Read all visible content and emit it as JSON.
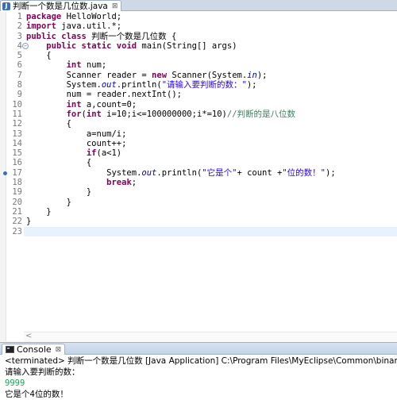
{
  "editor_tab": {
    "title": "判断一个数是几位数.java",
    "close_glyph": "⊠",
    "icon": "java-file-icon"
  },
  "editor": {
    "line_numbers": [
      "1",
      "2",
      "3",
      "4",
      "5",
      "6",
      "7",
      "8",
      "9",
      "10",
      "11",
      "12",
      "13",
      "14",
      "15",
      "16",
      "17",
      "18",
      "19",
      "20",
      "21",
      "22",
      "23"
    ],
    "lines": [
      [
        {
          "t": "kw",
          "v": "package"
        },
        {
          "t": "n",
          "v": " HelloWorld;"
        }
      ],
      [
        {
          "t": "kw",
          "v": "import"
        },
        {
          "t": "n",
          "v": " java.util.*;"
        }
      ],
      [
        {
          "t": "kw",
          "v": "public class"
        },
        {
          "t": "n",
          "v": " 判断一个数是几位数 {"
        }
      ],
      [
        {
          "t": "n",
          "v": "    "
        },
        {
          "t": "kw",
          "v": "public static void"
        },
        {
          "t": "n",
          "v": " main(String[] args)"
        }
      ],
      [
        {
          "t": "n",
          "v": "    {"
        }
      ],
      [
        {
          "t": "n",
          "v": "        "
        },
        {
          "t": "kw",
          "v": "int"
        },
        {
          "t": "n",
          "v": " num;"
        }
      ],
      [
        {
          "t": "n",
          "v": "        Scanner reader = "
        },
        {
          "t": "kw",
          "v": "new"
        },
        {
          "t": "n",
          "v": " Scanner(System."
        },
        {
          "t": "fld",
          "v": "in"
        },
        {
          "t": "n",
          "v": ");"
        }
      ],
      [
        {
          "t": "n",
          "v": "        System."
        },
        {
          "t": "fld",
          "v": "out"
        },
        {
          "t": "n",
          "v": ".println("
        },
        {
          "t": "str",
          "v": "\"请输入要判断的数：\""
        },
        {
          "t": "n",
          "v": ");"
        }
      ],
      [
        {
          "t": "n",
          "v": "        num = reader.nextInt();"
        }
      ],
      [
        {
          "t": "n",
          "v": "        "
        },
        {
          "t": "kw",
          "v": "int"
        },
        {
          "t": "n",
          "v": " a,count=0;"
        }
      ],
      [
        {
          "t": "n",
          "v": "        "
        },
        {
          "t": "kw",
          "v": "for"
        },
        {
          "t": "n",
          "v": "("
        },
        {
          "t": "kw",
          "v": "int"
        },
        {
          "t": "n",
          "v": " i=10;i<=100000000;i*=10)"
        },
        {
          "t": "cmt",
          "v": "//判断的是八位数"
        }
      ],
      [
        {
          "t": "n",
          "v": "        {"
        }
      ],
      [
        {
          "t": "n",
          "v": "            a=num/i;"
        }
      ],
      [
        {
          "t": "n",
          "v": "            count++;"
        }
      ],
      [
        {
          "t": "n",
          "v": "            "
        },
        {
          "t": "kw",
          "v": "if"
        },
        {
          "t": "n",
          "v": "(a<1)"
        }
      ],
      [
        {
          "t": "n",
          "v": "            {"
        }
      ],
      [
        {
          "t": "n",
          "v": "                System."
        },
        {
          "t": "fld",
          "v": "out"
        },
        {
          "t": "n",
          "v": ".println("
        },
        {
          "t": "str",
          "v": "\"它是个\""
        },
        {
          "t": "n",
          "v": "+ count +"
        },
        {
          "t": "str",
          "v": "\"位的数！\""
        },
        {
          "t": "n",
          "v": ");"
        }
      ],
      [
        {
          "t": "n",
          "v": "                "
        },
        {
          "t": "kw",
          "v": "break"
        },
        {
          "t": "n",
          "v": ";"
        }
      ],
      [
        {
          "t": "n",
          "v": "            }"
        }
      ],
      [
        {
          "t": "n",
          "v": "        }"
        }
      ],
      [
        {
          "t": "n",
          "v": "    }"
        }
      ],
      [
        {
          "t": "n",
          "v": "}"
        }
      ],
      [
        {
          "t": "n",
          "v": ""
        }
      ]
    ],
    "current_line": 23,
    "fold_line": 4,
    "override_line": 17,
    "scroll_left_glyph": "<"
  },
  "console": {
    "tab_label": "Console",
    "close_glyph": "⊠",
    "icon": "console-icon",
    "status": "<terminated> 判断一个数是几位数 [Java Application] C:\\Program Files\\MyEclipse\\Common\\binary\\com.sun.ja",
    "output": [
      {
        "kind": "out",
        "text": "请输入要判断的数："
      },
      {
        "kind": "input",
        "text": "9999"
      },
      {
        "kind": "out",
        "text": "它是个4位的数！"
      }
    ]
  },
  "colors": {
    "keyword": "#7f0055",
    "string": "#2a00ff",
    "field": "#0000c0",
    "comment": "#3f7f5f",
    "console_input": "#1aa35a",
    "current_line_bg": "#e8f2fe"
  }
}
